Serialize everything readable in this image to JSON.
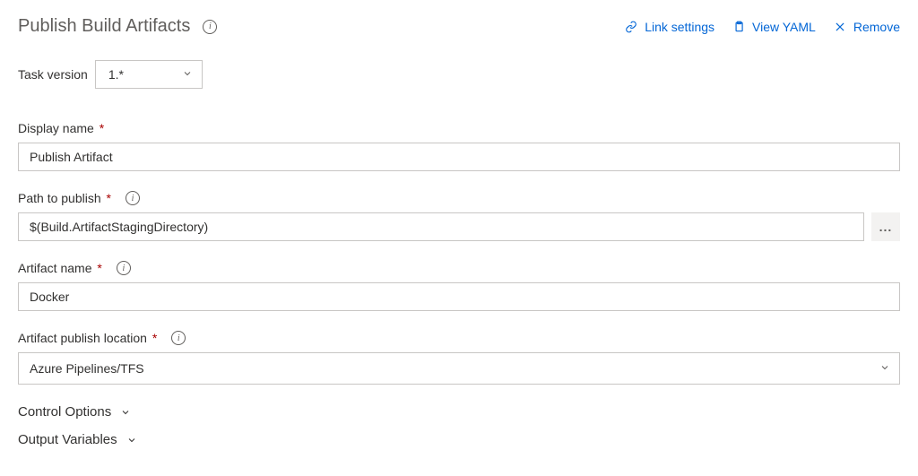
{
  "header": {
    "title": "Publish Build Artifacts",
    "actions": {
      "link_settings": "Link settings",
      "view_yaml": "View YAML",
      "remove": "Remove"
    }
  },
  "task_version": {
    "label": "Task version",
    "value": "1.*"
  },
  "fields": {
    "display_name": {
      "label": "Display name",
      "value": "Publish Artifact"
    },
    "path_to_publish": {
      "label": "Path to publish",
      "value": "$(Build.ArtifactStagingDirectory)"
    },
    "artifact_name": {
      "label": "Artifact name",
      "value": "Docker"
    },
    "publish_location": {
      "label": "Artifact publish location",
      "value": "Azure Pipelines/TFS"
    }
  },
  "sections": {
    "control_options": "Control Options",
    "output_variables": "Output Variables"
  },
  "glyph": {
    "required": "*",
    "ellipsis": "..."
  }
}
